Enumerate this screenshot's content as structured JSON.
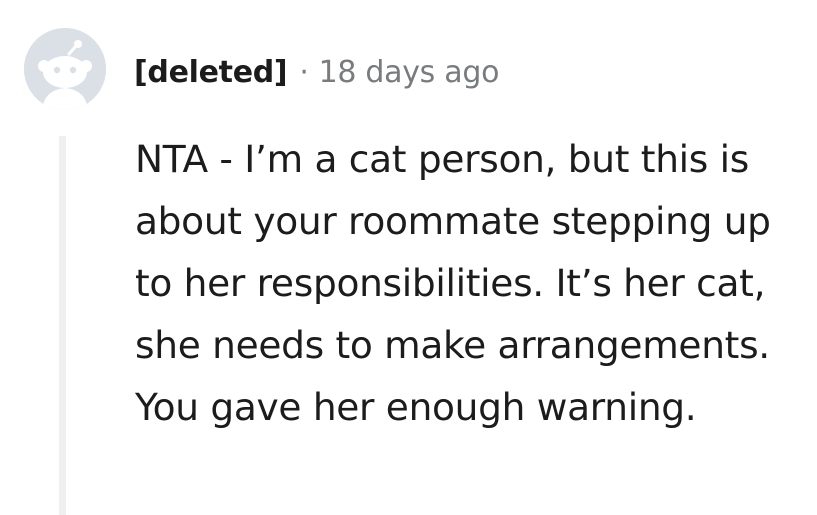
{
  "comment": {
    "author": "[deleted]",
    "separator": "·",
    "timestamp": "18 days ago",
    "body": "NTA - I’m a cat person, but this is about your roommate stepping up to her responsibilities. It’s her cat, she needs to make arrangements. You gave her enough warning."
  },
  "icons": {
    "avatar": "default-snoo-avatar-icon"
  },
  "colors": {
    "avatar_background": "#dae0e6",
    "thread_line": "#edeff1",
    "text_primary": "#1c1c1c",
    "text_muted": "#787c7e"
  }
}
